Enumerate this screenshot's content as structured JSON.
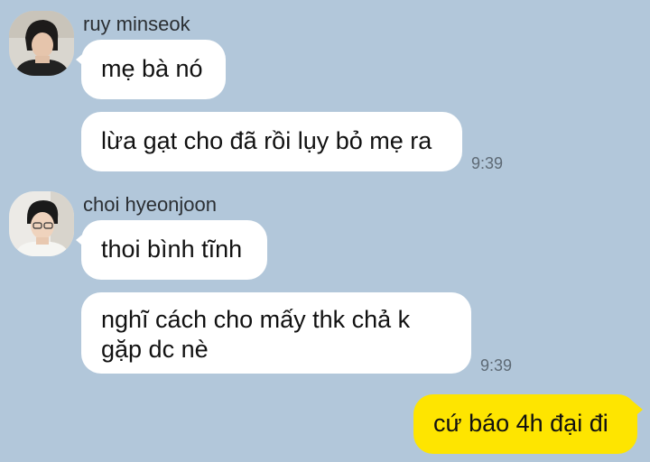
{
  "conversation": {
    "group1": {
      "sender_name": "ruy minseok",
      "avatar_icon": "profile-photo-icon",
      "messages": [
        {
          "text": "mẹ bà nó"
        },
        {
          "text": "lừa gạt cho đã rồi lụy bỏ mẹ ra"
        }
      ],
      "time": "9:39"
    },
    "group2": {
      "sender_name": "choi hyeonjoon",
      "avatar_icon": "profile-photo-icon",
      "messages": [
        {
          "text": "thoi bình tĩnh"
        },
        {
          "text": "nghĩ cách cho mấy thk chả k gặp dc nè"
        }
      ],
      "time": "9:39"
    },
    "outgoing": {
      "messages": [
        {
          "text": "cứ báo 4h đại đi"
        }
      ]
    }
  },
  "colors": {
    "background": "#b2c7da",
    "incoming_bubble": "#ffffff",
    "outgoing_bubble": "#fee500"
  }
}
